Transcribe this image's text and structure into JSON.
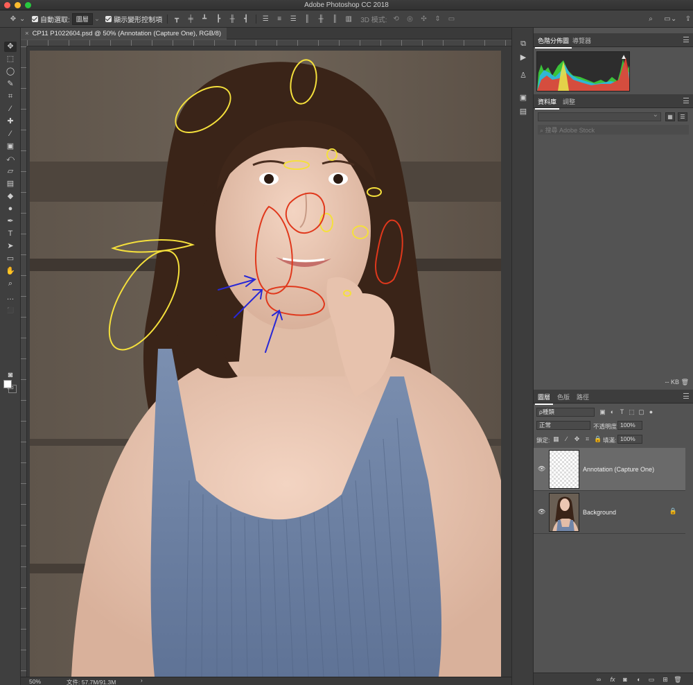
{
  "window": {
    "title": "Adobe Photoshop CC 2018"
  },
  "options_bar": {
    "auto_select_label": "自動選取:",
    "auto_select_value": "圖層",
    "show_transform_label": "顯示變形控制項",
    "mode_3d_label": "3D 模式:"
  },
  "document": {
    "tab_title": "CP11 P1022604.psd @ 50% (Annotation (Capture One), RGB/8)",
    "zoom": "50%",
    "doc_size": "文件: 57.7M/91.3M",
    "annotation_colors": {
      "yellow": "#f5e03c",
      "red": "#e0381c",
      "blue": "#2828d6"
    }
  },
  "panels": {
    "top_tabs": [
      "色階分佈圖",
      "導覽器"
    ],
    "library_tabs": [
      "資料庫",
      "調整"
    ],
    "stock_search_placeholder": "搜尋 Adobe Stock",
    "kb_label": "-- KB",
    "layer_tabs": [
      "圖層",
      "色版",
      "路徑"
    ],
    "layer_filter": "ρ種類",
    "blend_mode": "正常",
    "opacity_label": "不透明度:",
    "opacity_value": "100%",
    "lock_label": "鎖定:",
    "fill_label": "填滿:",
    "fill_value": "100%",
    "layers": [
      {
        "name": "Annotation (Capture One)",
        "selected": true,
        "visible": true,
        "locked": false
      },
      {
        "name": "Background",
        "selected": false,
        "visible": true,
        "locked": true
      }
    ]
  }
}
